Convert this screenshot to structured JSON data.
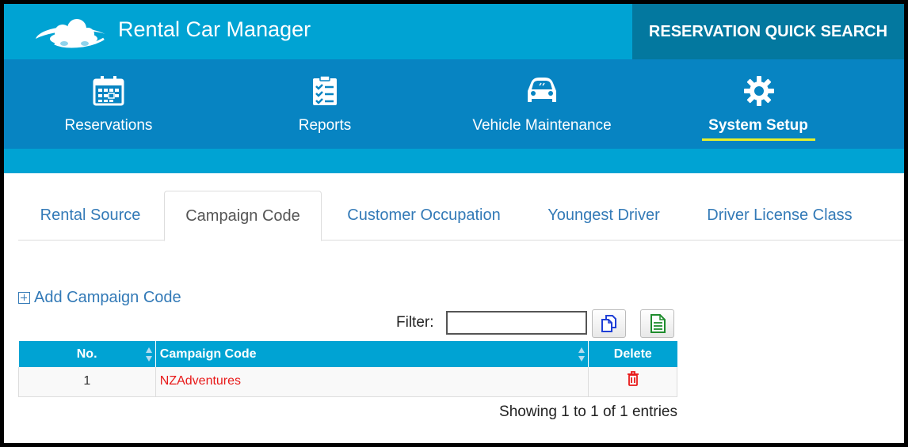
{
  "header": {
    "app_title": "Rental Car Manager",
    "quick_search": "RESERVATION QUICK SEARCH"
  },
  "nav": {
    "items": [
      {
        "label": "Reservations",
        "icon": "calendar-icon"
      },
      {
        "label": "Reports",
        "icon": "checklist-icon"
      },
      {
        "label": "Vehicle Maintenance",
        "icon": "car-icon"
      },
      {
        "label": "System Setup",
        "icon": "gear-icon",
        "active": true
      }
    ]
  },
  "tabs": {
    "items": [
      {
        "label": "Rental Source"
      },
      {
        "label": "Campaign Code",
        "active": true
      },
      {
        "label": "Customer Occupation"
      },
      {
        "label": "Youngest Driver"
      },
      {
        "label": "Driver License Class"
      }
    ]
  },
  "actions": {
    "add_label": "Add Campaign Code",
    "filter_label": "Filter:",
    "filter_value": ""
  },
  "table": {
    "headers": {
      "no": "No.",
      "code": "Campaign Code",
      "delete": "Delete"
    },
    "rows": [
      {
        "no": "1",
        "code": "NZAdventures"
      }
    ]
  },
  "footer": {
    "showing": "Showing 1 to 1 of 1 entries"
  },
  "colors": {
    "header_bg": "#00a3d3",
    "nav_bg": "#0784c2",
    "quick_search_bg": "#03789f",
    "link": "#337ab7",
    "delete_icon": "#e81919",
    "active_underline": "#e7f02b"
  }
}
